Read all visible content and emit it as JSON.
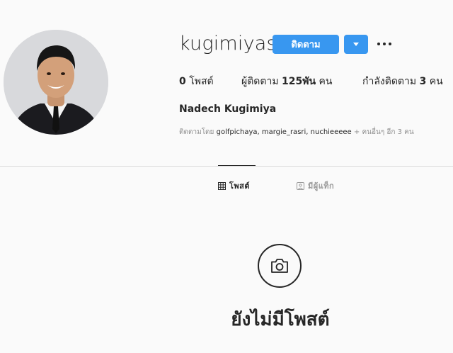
{
  "profile": {
    "username": "kugimiyas",
    "full_name": "Nadech Kugimiya",
    "follow_label": "ติดตาม"
  },
  "stats": {
    "posts_count": "0",
    "posts_label": "โพสต์",
    "followers_label": "ผู้ติดตาม",
    "followers_count": "125พัน",
    "followers_unit": "คน",
    "following_label": "กำลังติดตาม",
    "following_count": "3",
    "following_unit": "คน"
  },
  "followed_by": {
    "prefix": "ติดตามโดย",
    "names": "golfpichaya, margie_rasri, nuchieeeee",
    "suffix": "+ คนอื่นๆ อีก 3 คน"
  },
  "tabs": [
    {
      "label": "โพสต์",
      "icon": "grid-icon",
      "active": true
    },
    {
      "label": "มีผู้แท็ก",
      "icon": "tag-icon",
      "active": false
    }
  ],
  "empty_state": {
    "icon": "camera-icon",
    "title": "ยังไม่มีโพสต์"
  },
  "colors": {
    "accent": "#3897f0",
    "text": "#262626",
    "muted": "#8e8e8e",
    "background": "#fafafa"
  }
}
